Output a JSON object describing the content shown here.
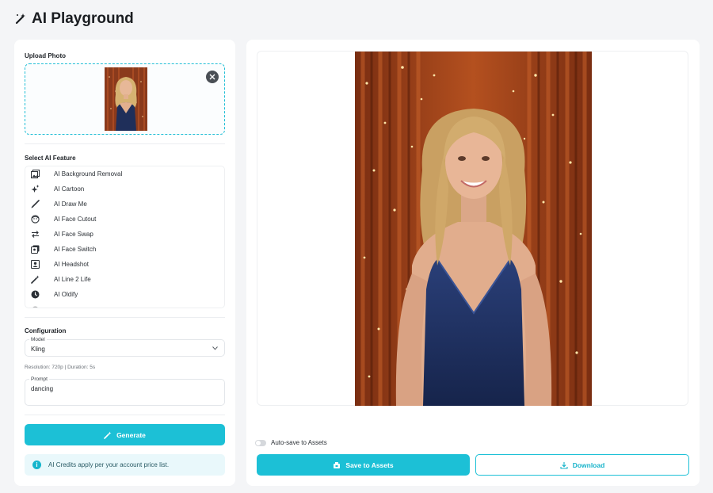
{
  "header": {
    "title": "AI Playground",
    "icon": "magic-wand-icon"
  },
  "upload": {
    "label": "Upload Photo"
  },
  "features": {
    "label": "Select AI Feature",
    "items": [
      {
        "label": "AI Background Removal",
        "icon": "gallery-icon"
      },
      {
        "label": "AI Cartoon",
        "icon": "sparkles-icon"
      },
      {
        "label": "AI Draw Me",
        "icon": "brush-icon"
      },
      {
        "label": "AI Face Cutout",
        "icon": "face-icon"
      },
      {
        "label": "AI Face Swap",
        "icon": "swap-icon"
      },
      {
        "label": "AI Face Switch",
        "icon": "layers-icon"
      },
      {
        "label": "AI Headshot",
        "icon": "portrait-icon"
      },
      {
        "label": "AI Line 2 Life",
        "icon": "wand-icon"
      },
      {
        "label": "AI Oldify",
        "icon": "clock-icon"
      }
    ]
  },
  "config": {
    "label": "Configuration",
    "model_label": "Model",
    "model_value": "Kling",
    "hint": "Resolution: 720p | Duration: 5s",
    "prompt_label": "Prompt",
    "prompt_value": "dancing"
  },
  "generate_label": "Generate",
  "info_text": "AI Credits apply per your account price list.",
  "autosave_label": "Auto-save to Assets",
  "autosave_on": false,
  "save_label": "Save to Assets",
  "download_label": "Download",
  "colors": {
    "accent": "#1cc0d6",
    "background": "#f4f5f7"
  }
}
